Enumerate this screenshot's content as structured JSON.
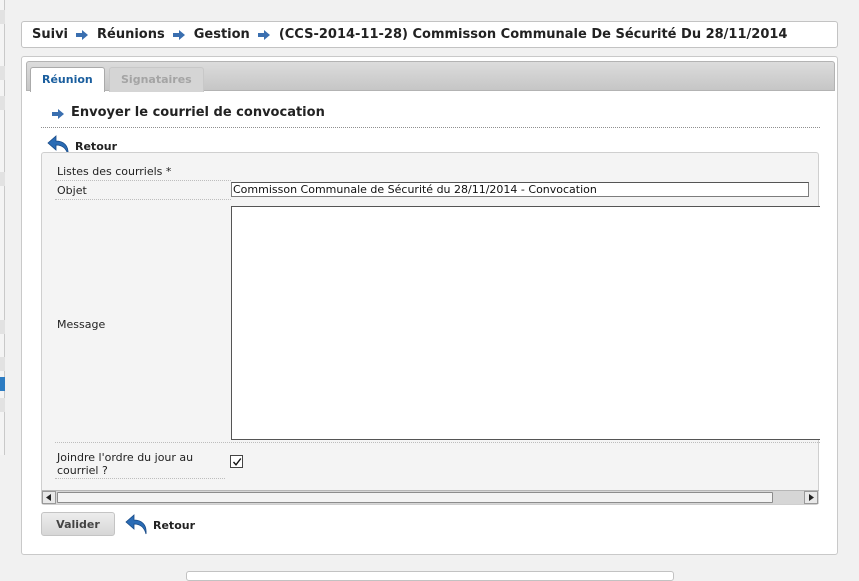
{
  "breadcrumb": {
    "items": [
      {
        "label": "Suivi"
      },
      {
        "label": "Réunions"
      },
      {
        "label": "Gestion"
      },
      {
        "label": "(CCS-2014-11-28) Commisson Communale De Sécurité Du 28/11/2014"
      }
    ],
    "separator_icon": "arrow-right-icon"
  },
  "tabs": [
    {
      "label": "Réunion",
      "active": true
    },
    {
      "label": "Signataires",
      "active": false
    }
  ],
  "section": {
    "title": "Envoyer le courriel de convocation",
    "icon": "arrow-right-icon"
  },
  "back_link": {
    "label": "Retour",
    "icon": "undo-arrow-icon"
  },
  "form": {
    "lists_label": "Listes des courriels *",
    "objet_label": "Objet",
    "objet_value": "Commisson Communale de Sécurité du 28/11/2014 - Convocation",
    "message_label": "Message",
    "message_value": "",
    "join_label": "Joindre l'ordre du jour au courriel ?",
    "join_checked": true
  },
  "actions": {
    "submit_label": "Valider",
    "back_label": "Retour"
  },
  "colors": {
    "accent": "#1a5e9e",
    "arrow": "#3a6fb0",
    "background": "#f1f1f1"
  }
}
